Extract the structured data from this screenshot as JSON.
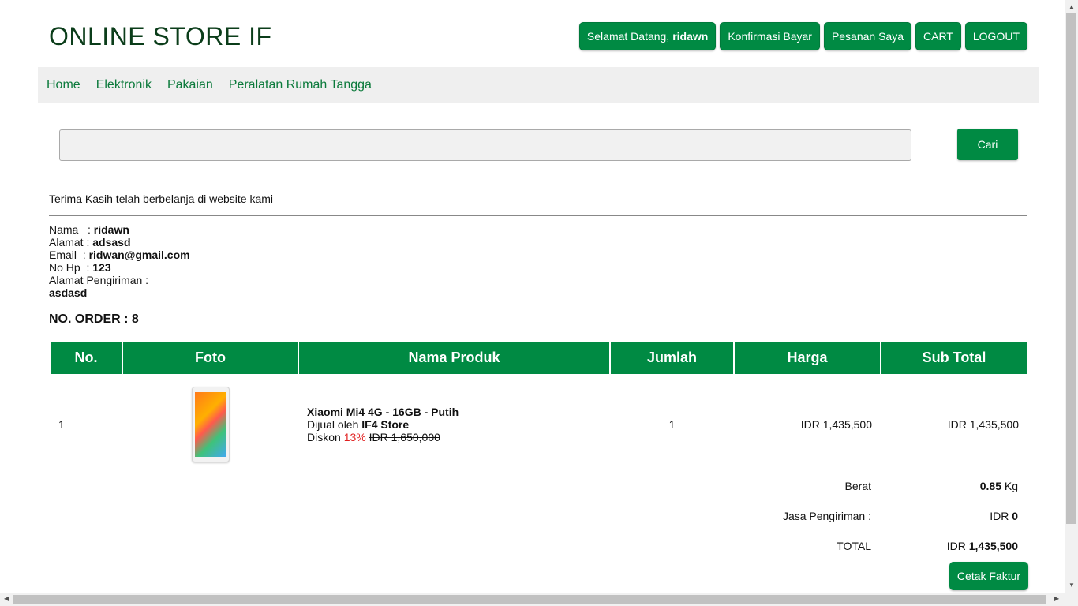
{
  "header": {
    "brand": "ONLINE STORE IF",
    "welcome_prefix": "Selamat Datang,",
    "username": "ridawn",
    "buttons": {
      "konfirmasi": "Konfirmasi Bayar",
      "pesanan": "Pesanan Saya",
      "cart": "CART",
      "logout": "LOGOUT"
    }
  },
  "nav": [
    "Home",
    "Elektronik",
    "Pakaian",
    "Peralatan Rumah Tangga"
  ],
  "search": {
    "value": "",
    "button": "Cari"
  },
  "thanks": "Terima Kasih telah berbelanja di website kami",
  "customer": {
    "nama_label": "Nama   :",
    "nama": "ridawn",
    "alamat_label": "Alamat :",
    "alamat": "adsasd",
    "email_label": "Email  :",
    "email": "ridwan@gmail.com",
    "hp_label": "No Hp  :",
    "hp": "123",
    "pengiriman_label": "Alamat Pengiriman :",
    "pengiriman": "asdasd"
  },
  "order": {
    "label": "NO. ORDER :",
    "number": "8"
  },
  "table": {
    "headers": [
      "No.",
      "Foto",
      "Nama Produk",
      "Jumlah",
      "Harga",
      "Sub Total"
    ],
    "rows": [
      {
        "no": "1",
        "photo_icon": "phone-image",
        "name": "Xiaomi Mi4 4G - 16GB - Putih",
        "seller_prefix": "Dijual oleh",
        "seller": "IF4 Store",
        "discount_prefix": "Diskon",
        "discount": "13%",
        "original_price": "IDR 1,650,000",
        "qty": "1",
        "price": "IDR 1,435,500",
        "subtotal": "IDR 1,435,500"
      }
    ]
  },
  "summary": {
    "berat_label": "Berat",
    "berat_value": "0.85",
    "berat_unit": "Kg",
    "jasa_label": "Jasa Pengiriman :",
    "jasa_currency": "IDR",
    "jasa_value": "0",
    "total_label": "TOTAL",
    "total_currency": "IDR",
    "total_value": "1,435,500"
  },
  "print_button": "Cetak Faktur",
  "colors": {
    "accent": "#008a43",
    "nav_bg": "#efefef",
    "discount": "#e02020"
  }
}
